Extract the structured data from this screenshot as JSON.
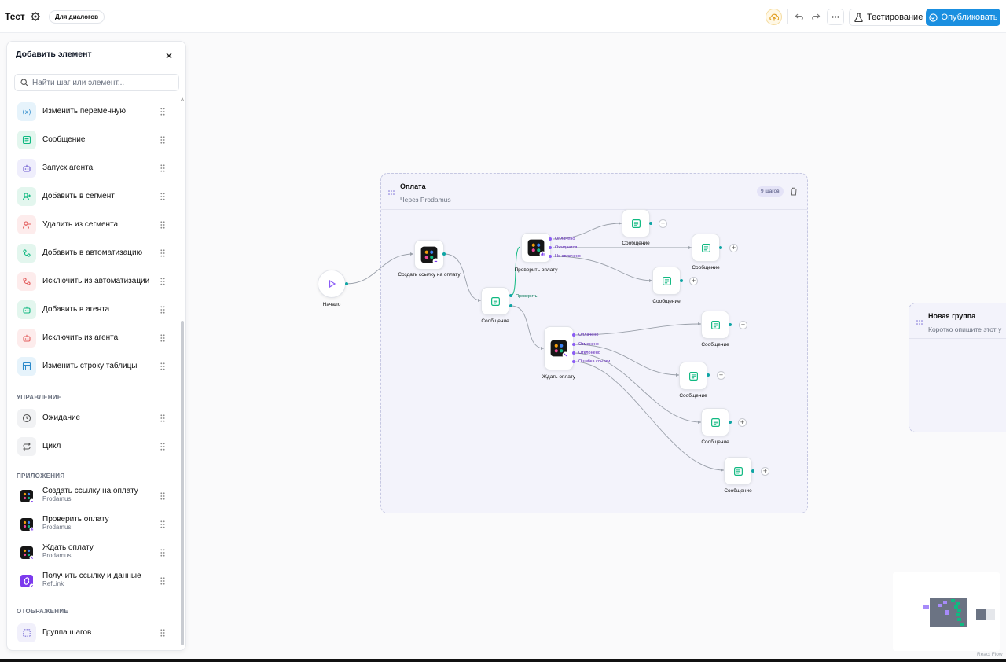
{
  "header": {
    "title": "Тест",
    "badge": "Для диалогов",
    "test_label": "Тестирование",
    "publish_label": "Опубликовать"
  },
  "panel": {
    "title": "Добавить элемент",
    "search_placeholder": "Найти шаг или элемент...",
    "items": [
      {
        "label": "Изменить переменную",
        "icon": "variable-icon"
      },
      {
        "label": "Сообщение",
        "icon": "message-icon"
      },
      {
        "label": "Запуск агента",
        "icon": "robot-icon"
      },
      {
        "label": "Добавить в сегмент",
        "icon": "user-add-icon"
      },
      {
        "label": "Удалить из сегмента",
        "icon": "user-remove-icon"
      },
      {
        "label": "Добавить в автоматизацию",
        "icon": "automation-add-icon"
      },
      {
        "label": "Исключить из автоматизации",
        "icon": "automation-remove-icon"
      },
      {
        "label": "Добавить в агента",
        "icon": "robot-add-icon"
      },
      {
        "label": "Исключить из агента",
        "icon": "robot-remove-icon"
      },
      {
        "label": "Изменить строку таблицы",
        "icon": "table-icon"
      }
    ],
    "section_control": "УПРАВЛЕНИЕ",
    "control_items": [
      {
        "label": "Ожидание",
        "icon": "clock-icon"
      },
      {
        "label": "Цикл",
        "icon": "loop-icon"
      }
    ],
    "section_apps": "ПРИЛОЖЕНИЯ",
    "app_items": [
      {
        "label": "Создать ссылку на оплату",
        "sub": "Prodamus"
      },
      {
        "label": "Проверить оплату",
        "sub": "Prodamus"
      },
      {
        "label": "Ждать оплату",
        "sub": "Prodamus"
      },
      {
        "label": "Получить ссылку и данные",
        "sub": "RefLink"
      }
    ],
    "section_display": "ОТОБРАЖЕНИЕ",
    "display_items": [
      {
        "label": "Группа шагов",
        "icon": "group-icon"
      }
    ]
  },
  "canvas": {
    "group_main": {
      "title": "Оплата",
      "description": "Через Prodamus",
      "count": "9 шагов"
    },
    "group_new": {
      "title": "Новая группа",
      "description": "Коротко опишите этот у"
    },
    "start_label": "Начало",
    "nodes": {
      "create_link": "Создать ссылку на оплату",
      "msg1": "Сообщение",
      "check": "Проверить оплату",
      "wait": "Ждать оплату",
      "msg_a": "Сообщение",
      "msg_b": "Сообщение",
      "msg_c": "Сообщение",
      "msg_d": "Сообщение",
      "msg_e": "Сообщение",
      "msg_f": "Сообщение",
      "msg_g": "Сообщение"
    },
    "ports": {
      "msg1_out": "Проверить",
      "check_paid": "Оплачено",
      "check_pending": "Ожидается",
      "check_unpaid": "Не оплачено",
      "wait_paid": "Оплачено",
      "wait_cancel": "Отменено",
      "wait_reject": "Отклонено",
      "wait_error": "Ошибка ссылки"
    },
    "plus": "+"
  },
  "minimap": {
    "credit": "React Flow"
  },
  "colors": {
    "accent": "#1a8fe0",
    "port": "#5b21b6",
    "handle": "#0ea5a4",
    "message": "#10b981"
  }
}
